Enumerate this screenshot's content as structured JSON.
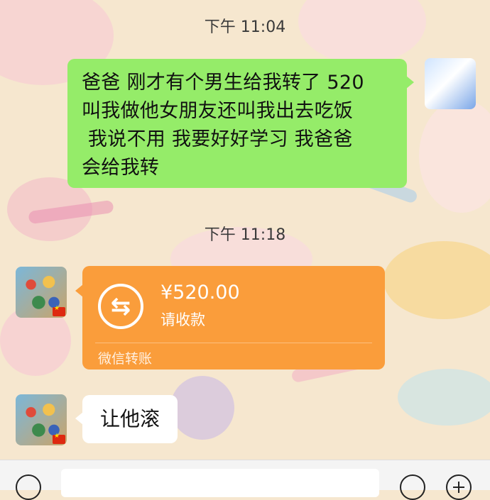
{
  "chat": {
    "messages": [
      {
        "time": "下午 11:04",
        "sender": "me",
        "lines": [
          "爸爸 刚才有个男生给我转了 520",
          "叫我做他女朋友还叫我出去吃饭",
          " 我说不用 我要好好学习 我爸爸",
          "会给我转"
        ]
      },
      {
        "time": "下午 11:18",
        "sender": "dad",
        "type": "transfer",
        "amount": "¥520.00",
        "status": "请收款",
        "footer": "微信转账",
        "icon": "transfer-arrows-icon"
      },
      {
        "sender": "dad",
        "text": "让他滚"
      }
    ]
  },
  "colors": {
    "outgoing_bubble": "#95ec69",
    "transfer_card": "#fa9d3b",
    "incoming_bubble": "#ffffff",
    "background": "#f6e7cf"
  },
  "input_bar": {
    "icons": [
      "voice-icon",
      "emoji-icon",
      "plus-icon"
    ]
  }
}
